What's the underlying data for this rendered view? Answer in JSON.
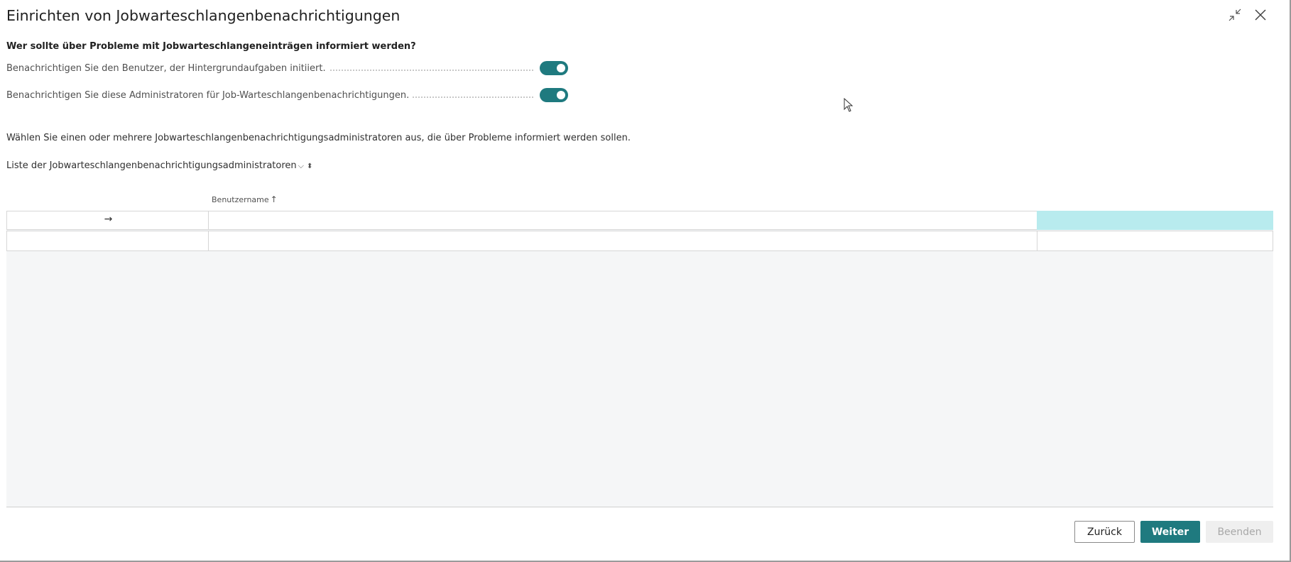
{
  "dialog": {
    "title": "Einrichten von Jobwarteschlangenbenachrichtigungen",
    "question": "Wer sollte über Probleme mit Jobwarteschlangeneinträgen informiert werden?",
    "fields": [
      {
        "label": "Benachrichtigen Sie den Benutzer, der Hintergrundaufgaben initiiert.",
        "value": true
      },
      {
        "label": "Benachrichtigen Sie diese Administratoren für Job-Warteschlangenbenachrichtigungen.",
        "value": true
      }
    ],
    "instruction": "Wählen Sie einen oder mehrere Jobwarteschlangenbenachrichtigungsadministratoren aus, die über Probleme informiert werden sollen.",
    "list_caption": "Liste der Jobwarteschlangenbenachrichtigungsadministratoren",
    "list_caption_chevron": "⌵",
    "list_caption_sort": "⬍"
  },
  "grid": {
    "column_header": "Benutzername",
    "sort_indicator": "↑",
    "row_marker": "→"
  },
  "footer": {
    "back_label": "Zurück",
    "next_label": "Weiter",
    "finish_label": "Beenden"
  },
  "colors": {
    "accent": "#1f7a7f",
    "selected_cell": "#b8ebee",
    "grid_background": "#f5f6f7"
  },
  "icons": {
    "collapse": "collapse-icon",
    "close": "close-icon",
    "cursor": "mouse-pointer-icon"
  }
}
